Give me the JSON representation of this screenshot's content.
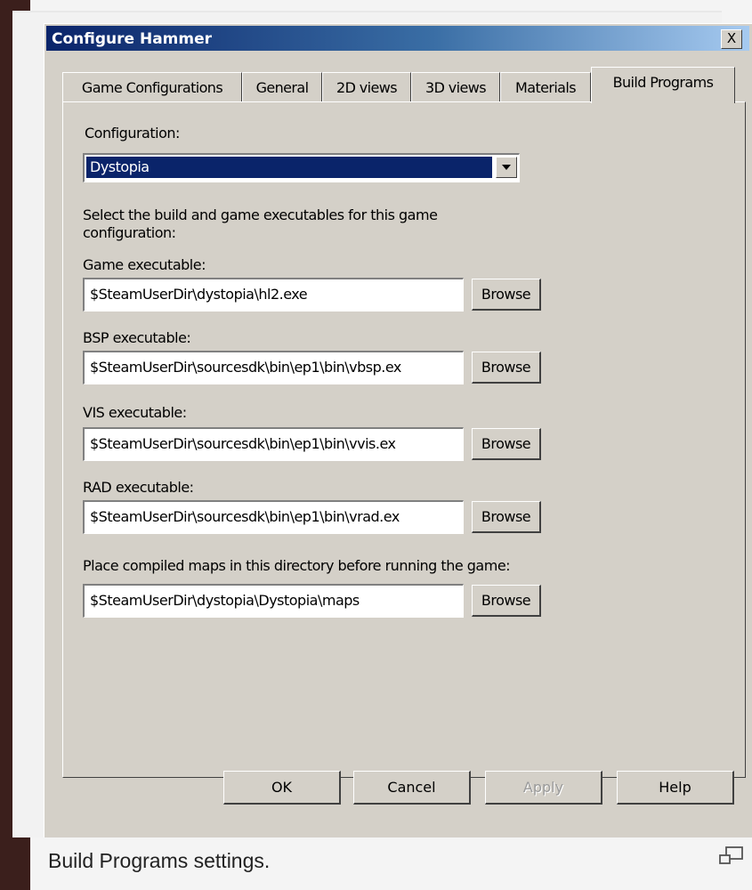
{
  "dialog": {
    "title": "Configure Hammer",
    "close_label": "X",
    "tabs": [
      {
        "label": "Game Configurations",
        "active": false
      },
      {
        "label": "General",
        "active": false
      },
      {
        "label": "2D views",
        "active": false
      },
      {
        "label": "3D views",
        "active": false
      },
      {
        "label": "Materials",
        "active": false
      },
      {
        "label": "Build Programs",
        "active": true
      }
    ],
    "configuration": {
      "label": "Configuration:",
      "value": "Dystopia"
    },
    "instructions": "Select the build and game executables for this game configuration:",
    "fields": [
      {
        "label": "Game executable:",
        "value": "$SteamUserDir\\dystopia\\hl2.exe",
        "button": "Browse"
      },
      {
        "label": "BSP executable:",
        "value": "$SteamUserDir\\sourcesdk\\bin\\ep1\\bin\\vbsp.ex",
        "button": "Browse"
      },
      {
        "label": "VIS executable:",
        "value": "$SteamUserDir\\sourcesdk\\bin\\ep1\\bin\\vvis.ex",
        "button": "Browse"
      },
      {
        "label": "RAD executable:",
        "value": "$SteamUserDir\\sourcesdk\\bin\\ep1\\bin\\vrad.ex",
        "button": "Browse"
      },
      {
        "label": "Place compiled maps in this directory before running the game:",
        "value": "$SteamUserDir\\dystopia\\Dystopia\\maps",
        "button": "Browse"
      }
    ],
    "buttons": {
      "ok": "OK",
      "cancel": "Cancel",
      "apply": "Apply",
      "help": "Help"
    }
  },
  "caption": "Build Programs settings.",
  "icons": {
    "enlarge": "enlarge-icon"
  },
  "colors": {
    "title_gradient_start": "#0a246a",
    "title_gradient_end": "#a6caf0",
    "dialog_face": "#d4d0c8",
    "selection": "#0a246a",
    "backdrop": "#3b1f1c"
  }
}
